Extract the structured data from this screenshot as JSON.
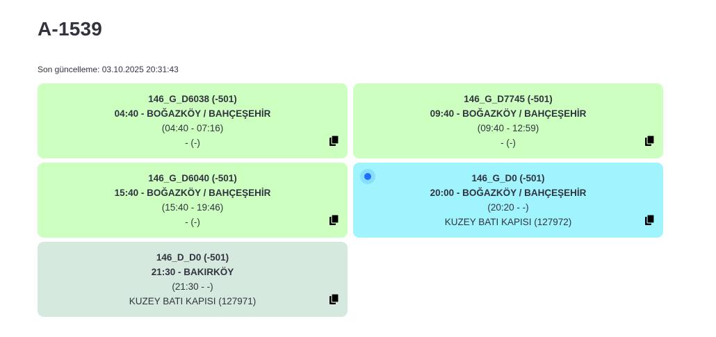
{
  "header": {
    "title": "A-1539",
    "last_updated": "Son güncelleme: 03.10.2025 20:31:43"
  },
  "colors": {
    "done": "#ccffc0",
    "active": "#9ff4fe",
    "upcoming": "#d6e9de"
  },
  "trips": [
    {
      "code": "146_G_D6038 (-501)",
      "route": "04:40 - BOĞAZKÖY / BAHÇEŞEHİR",
      "times": "(04:40 - 07:16)",
      "stop": "- (-)",
      "status": "done",
      "icon": "copy-icon"
    },
    {
      "code": "146_G_D7745 (-501)",
      "route": "09:40 - BOĞAZKÖY / BAHÇEŞEHİR",
      "times": "(09:40 - 12:59)",
      "stop": "- (-)",
      "status": "done",
      "icon": "copy-icon"
    },
    {
      "code": "146_G_D6040 (-501)",
      "route": "15:40 - BOĞAZKÖY / BAHÇEŞEHİR",
      "times": "(15:40 - 19:46)",
      "stop": "- (-)",
      "status": "done",
      "icon": "copy-icon"
    },
    {
      "code": "146_G_D0 (-501)",
      "route": "20:00 - BOĞAZKÖY / BAHÇEŞEHİR",
      "times": "(20:20 - -)",
      "stop": "KUZEY BATI KAPISI (127972)",
      "status": "active",
      "icon": "copy-icon"
    },
    {
      "code": "146_D_D0 (-501)",
      "route": "21:30 - BAKIRKÖY",
      "times": "(21:30 - -)",
      "stop": "KUZEY BATI KAPISI (127971)",
      "status": "upcoming",
      "icon": "copy-icon"
    }
  ]
}
